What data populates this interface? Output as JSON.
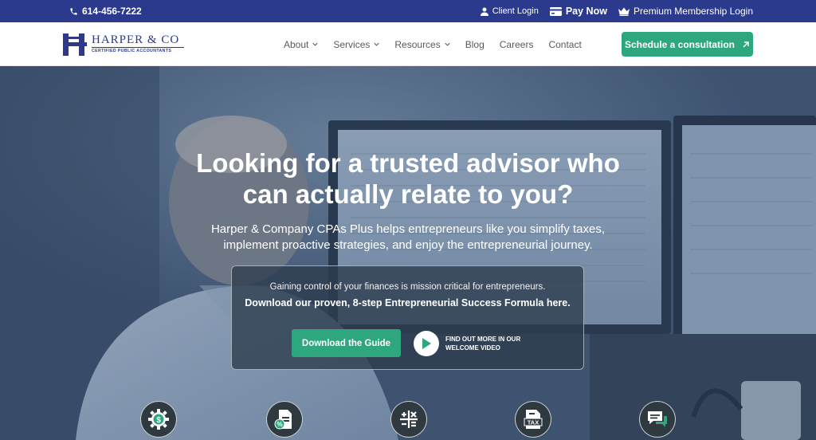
{
  "topbar": {
    "phone": "614-456-7222",
    "client_login": "Client Login",
    "pay_now": "Pay Now",
    "membership_login": "Premium Membership Login"
  },
  "logo": {
    "name": "HARPER & CO",
    "tagline": "CERTIFIED PUBLIC ACCOUNTANTS"
  },
  "nav": {
    "items": [
      {
        "label": "About",
        "has_dropdown": true
      },
      {
        "label": "Services",
        "has_dropdown": true
      },
      {
        "label": "Resources",
        "has_dropdown": true
      },
      {
        "label": "Blog",
        "has_dropdown": false
      },
      {
        "label": "Careers",
        "has_dropdown": false
      },
      {
        "label": "Contact",
        "has_dropdown": false
      }
    ],
    "cta_label": "Schedule a consultation"
  },
  "hero": {
    "headline_line1": "Looking for a trusted advisor who",
    "headline_line2": "can actually relate to you?",
    "subline_line1": "Harper & Company CPAs Plus helps entrepreneurs like you simplify taxes,",
    "subline_line2": "implement proactive strategies, and enjoy the entrepreneurial journey.",
    "guide": {
      "line1": "Gaining control of your finances is mission critical for entrepreneurs.",
      "line2": "Download our proven, 8-step Entrepreneurial Success Formula here.",
      "button_label": "Download the Guide",
      "video_line1": "FIND OUT MORE IN OUR",
      "video_line2": "WELCOME VIDEO"
    }
  },
  "features": {
    "icons": [
      "gear-dollar-icon",
      "document-percent-icon",
      "calculator-icon",
      "tax-document-icon",
      "chat-bubbles-icon"
    ],
    "tax_label": "TAX"
  },
  "colors": {
    "brand_navy": "#2b3a8c",
    "accent_green": "#2ea77f",
    "nav_text": "#5a5a5a"
  }
}
